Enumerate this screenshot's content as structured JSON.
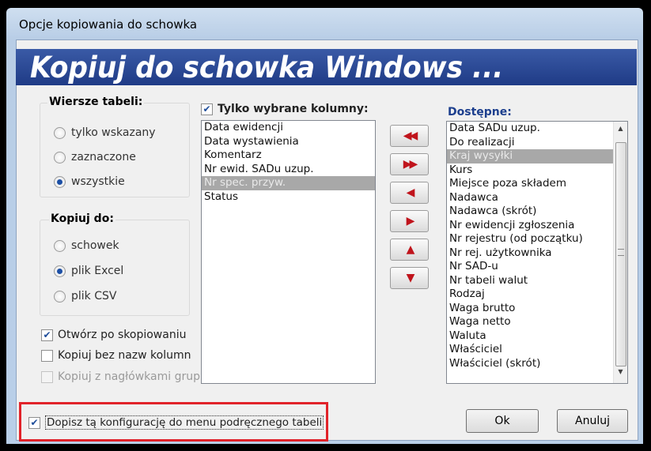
{
  "window": {
    "title": "Opcje kopiowania do schowka",
    "banner": "Kopiuj do schowka Windows ..."
  },
  "rows_group": {
    "title": "Wiersze tabeli:",
    "options": [
      {
        "label": "tylko wskazany",
        "selected": false
      },
      {
        "label": "zaznaczone",
        "selected": false
      },
      {
        "label": "wszystkie",
        "selected": true
      }
    ]
  },
  "copyto_group": {
    "title": "Kopiuj do:",
    "options": [
      {
        "label": "schowek",
        "selected": false
      },
      {
        "label": "plik Excel",
        "selected": true
      },
      {
        "label": "plik CSV",
        "selected": false
      }
    ]
  },
  "checkboxes": {
    "open_after": {
      "label": "Otwórz po skopiowaniu",
      "checked": true
    },
    "no_headers": {
      "label": "Kopiuj bez nazw kolumn",
      "checked": false
    },
    "group_headers": {
      "label": "Kopiuj z nagłówkami grup",
      "checked": false,
      "enabled": false
    },
    "add_config": {
      "label": "Dopisz tą konfigurację do menu podręcznego tabeli",
      "checked": true
    }
  },
  "selected_columns": {
    "checkbox_label": "Tylko wybrane kolumny:",
    "checked": true,
    "items": [
      "Data ewidencji",
      "Data wystawienia",
      "Komentarz",
      "Nr ewid. SADu uzup.",
      "Nr spec. przyw.",
      "Status"
    ],
    "selected_index": 4
  },
  "available": {
    "title": "Dostępne:",
    "items": [
      "Data SADu uzup.",
      "Do realizacji",
      "Kraj wysyłki",
      "Kurs",
      "Miejsce poza składem",
      "Nadawca",
      "Nadawca (skrót)",
      "Nr ewidencji zgłoszenia",
      "Nr rejestru (od początku)",
      "Nr rej. użytkownika",
      "Nr SAD-u",
      "Nr tabeli walut",
      "Rodzaj",
      "Waga brutto",
      "Waga netto",
      "Waluta",
      "Właściciel",
      "Właściciel (skrót)"
    ],
    "selected_index": 2
  },
  "arrows": [
    {
      "name": "move-all-left",
      "glyph": "◀◀"
    },
    {
      "name": "move-all-right",
      "glyph": "▶▶"
    },
    {
      "name": "move-left",
      "glyph": "◀"
    },
    {
      "name": "move-right",
      "glyph": "▶"
    },
    {
      "name": "move-up",
      "glyph": "▲"
    },
    {
      "name": "move-down",
      "glyph": "▼"
    }
  ],
  "buttons": {
    "ok": "Ok",
    "cancel": "Anuluj"
  },
  "colors": {
    "banner": "#2a4a9a",
    "selection": "#a8a8a8",
    "arrow": "#c0141c",
    "highlight": "#e1232a"
  }
}
